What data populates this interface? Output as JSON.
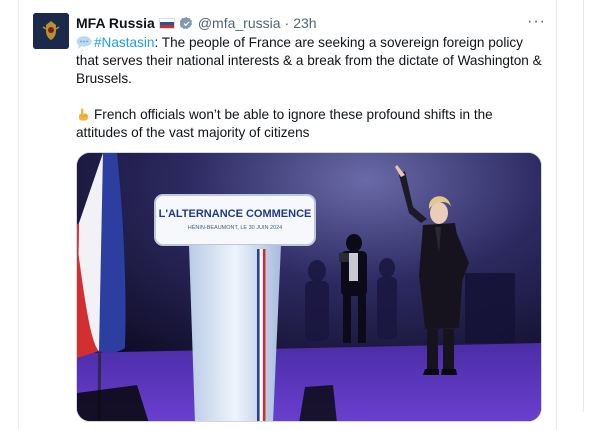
{
  "tweet": {
    "author_name": "MFA Russia",
    "handle": "@mfa_russia",
    "separator": "·",
    "time": "23h",
    "more_label": "···",
    "hashtag": "#Nastasin",
    "paragraph1_rest": ": The people of France are seeking a sovereign foreign policy that serves their national interests & a break from the dictate of Washington & Brussels.",
    "paragraph2": "French officials won’t be able to ignore these profound shifts in the attitudes of the vast majority of citizens",
    "emoji1": "speech-balloon-icon",
    "emoji2": "pointing-hand-icon"
  },
  "media": {
    "podium_title": "L'ALTERNANCE COMMENCE",
    "podium_subtitle": "HÉNIN-BEAUMONT, LE 30 JUIN 2024"
  },
  "colors": {
    "hashtag": "#1d9bf0",
    "muted": "#536471",
    "verified": "#829aab"
  }
}
